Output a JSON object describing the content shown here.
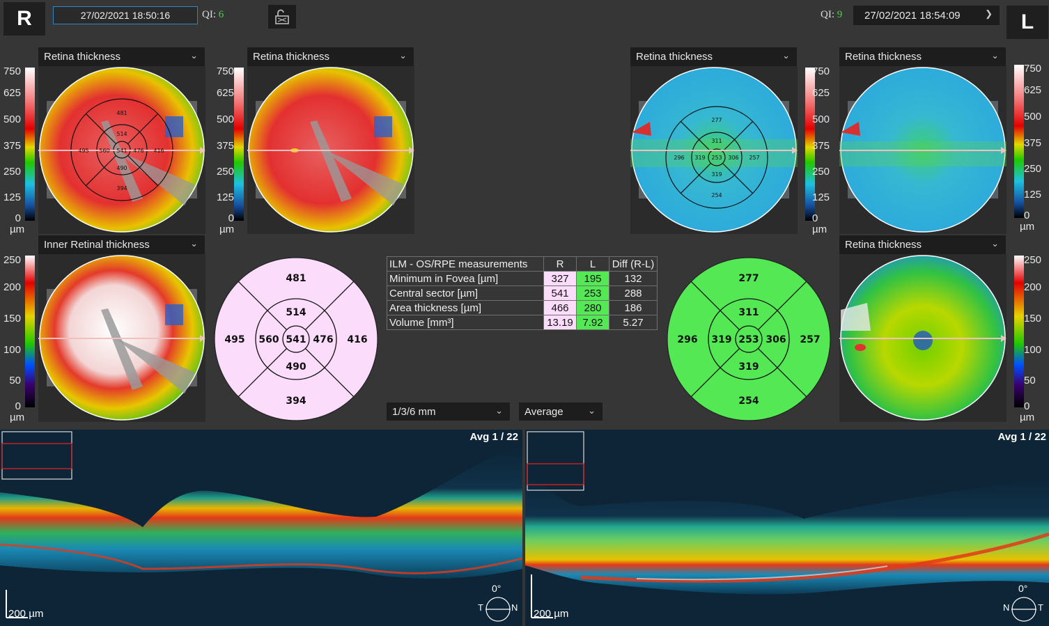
{
  "header": {
    "right_eye_badge": "R",
    "left_eye_badge": "L",
    "right_datetime": "27/02/2021 18:50:16",
    "left_datetime": "27/02/2021 18:54:09",
    "qi_label": "QI:",
    "right_qi": "6",
    "left_qi": "9"
  },
  "maps": {
    "right_top_a": "Retina thickness",
    "right_top_b": "Retina thickness",
    "left_top_a": "Retina thickness",
    "left_top_b": "Retina thickness",
    "right_inner": "Inner Retinal thickness",
    "left_bottom": "Retina thickness"
  },
  "scales": {
    "thickness": [
      "750",
      "625",
      "500",
      "375",
      "250",
      "125",
      "0"
    ],
    "inner": [
      "250",
      "200",
      "150",
      "100",
      "50",
      "0"
    ],
    "unit": "µm"
  },
  "right_grid": {
    "top": "481",
    "inner_top": "514",
    "center": "541",
    "inner_left": "560",
    "inner_right": "476",
    "inner_bottom": "490",
    "outer_left": "495",
    "outer_right": "416",
    "bottom": "394"
  },
  "left_grid": {
    "top": "277",
    "inner_top": "311",
    "center": "253",
    "inner_left": "319",
    "inner_right": "306",
    "inner_bottom": "319",
    "outer_left": "296",
    "outer_right": "257",
    "bottom": "254"
  },
  "measurements": {
    "title": "ILM - OS/RPE measurements",
    "col_r": "R",
    "col_l": "L",
    "col_diff": "Diff (R-L)",
    "rows": [
      {
        "label": "Minimum in Fovea [µm]",
        "r": "327",
        "l": "195",
        "diff": "132"
      },
      {
        "label": "Central sector [µm]",
        "r": "541",
        "l": "253",
        "diff": "288"
      },
      {
        "label": "Area thickness [µm]",
        "r": "466",
        "l": "280",
        "diff": "186"
      },
      {
        "label": "Volume [mm³]",
        "r": "13.19",
        "l": "7.92",
        "diff": "5.27"
      }
    ]
  },
  "controls": {
    "grid_select": "1/3/6 mm",
    "mode_select": "Average"
  },
  "bscans": {
    "right_avg": "Avg 1 / 22",
    "left_avg": "Avg 1 / 22",
    "scale_bar": "200 µm",
    "angle": "0°",
    "right_t": "T",
    "right_n": "N",
    "left_n": "N",
    "left_t": "T"
  },
  "colors": {
    "accent_qi": "#3ed93e",
    "right_sector_fill": "#fbdcfb",
    "left_sector_fill": "#55e855",
    "date_border": "#2f86c5"
  }
}
